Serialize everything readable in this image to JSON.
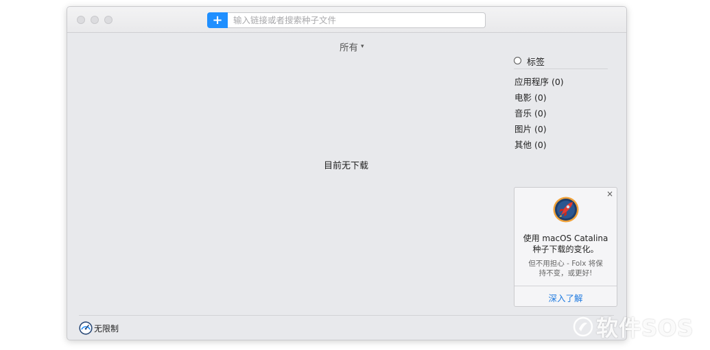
{
  "toolbar": {
    "add_label": "+",
    "search_placeholder": "输入链接或者搜索种子文件"
  },
  "filter": {
    "label": "所有"
  },
  "main": {
    "empty_message": "目前无下载"
  },
  "tags": {
    "title": "标签",
    "items": [
      {
        "label": "应用程序 (0)"
      },
      {
        "label": "电影 (0)"
      },
      {
        "label": "音乐 (0)"
      },
      {
        "label": "图片 (0)"
      },
      {
        "label": "其他 (0)"
      }
    ]
  },
  "promo": {
    "close": "×",
    "title_line1": "使用 macOS Catalina",
    "title_line2": "种子下载的变化。",
    "sub_line1": "但不用担心 - Folx 将保",
    "sub_line2": "持不变，或更好!",
    "link": "深入了解"
  },
  "status": {
    "speed_label": "无限制"
  },
  "watermark": {
    "text": "软件SOS"
  },
  "colors": {
    "accent": "#1f8fff",
    "link": "#1f7ae0",
    "window_bg": "#e8e9ec"
  },
  "icons": {
    "add": "plus-icon",
    "speed": "speedometer-icon",
    "promo": "rocket-icon"
  }
}
